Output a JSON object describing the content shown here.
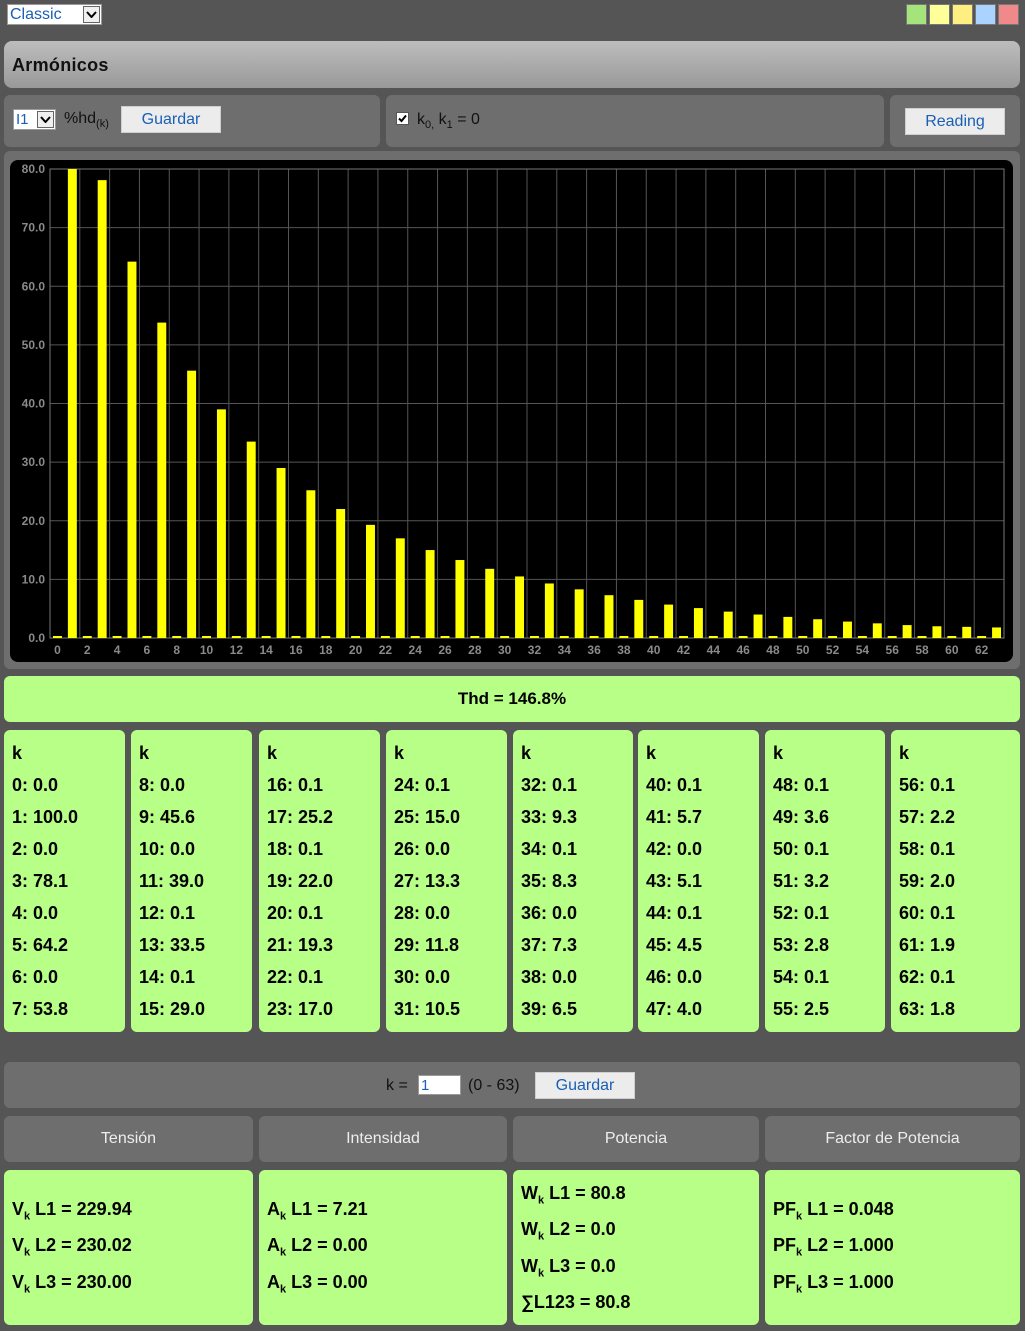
{
  "theme": {
    "selected": "Classic"
  },
  "swatch_colors": [
    "#a5e47a",
    "#ffff99",
    "#ffee80",
    "#aad4ff",
    "#f08a8a"
  ],
  "title": "Armónicos",
  "controls": {
    "line_select": "I1",
    "unit_main": "%hd",
    "unit_sub": "(k)",
    "save_label": "Guardar",
    "k0k1_main": "k",
    "k0k1_sub0": "0,",
    "k0k1_mid": " k",
    "k0k1_sub1": "1",
    "k0k1_tail": " = 0",
    "k0k1_checked": true,
    "reading_label": "Reading"
  },
  "chart_data": {
    "type": "bar",
    "ylim": [
      0,
      80
    ],
    "yticks": [
      "0.0",
      "10.0",
      "20.0",
      "30.0",
      "40.0",
      "50.0",
      "60.0",
      "70.0",
      "80.0"
    ],
    "xticks": [
      "0",
      "2",
      "4",
      "6",
      "8",
      "10",
      "12",
      "14",
      "16",
      "18",
      "20",
      "22",
      "24",
      "26",
      "28",
      "30",
      "32",
      "34",
      "36",
      "38",
      "40",
      "42",
      "44",
      "46",
      "48",
      "50",
      "52",
      "54",
      "56",
      "58",
      "60",
      "62"
    ],
    "bar_color": "#ffff00",
    "values": [
      0.0,
      100.0,
      0.0,
      78.1,
      0.0,
      64.2,
      0.0,
      53.8,
      0.0,
      45.6,
      0.0,
      39.0,
      0.1,
      33.5,
      0.1,
      29.0,
      0.1,
      25.2,
      0.1,
      22.0,
      0.1,
      19.3,
      0.1,
      17.0,
      0.1,
      15.0,
      0.0,
      13.3,
      0.0,
      11.8,
      0.0,
      10.5,
      0.1,
      9.3,
      0.1,
      8.3,
      0.0,
      7.3,
      0.0,
      6.5,
      0.1,
      5.7,
      0.0,
      5.1,
      0.1,
      4.5,
      0.0,
      4.0,
      0.1,
      3.6,
      0.1,
      3.2,
      0.1,
      2.8,
      0.1,
      2.5,
      0.1,
      2.2,
      0.1,
      2.0,
      0.1,
      1.9,
      0.1,
      1.8
    ]
  },
  "thd": "Thd = 146.8%",
  "columns": [
    {
      "header": "k",
      "rows": [
        "0: 0.0",
        "1: 100.0",
        "2: 0.0",
        "3: 78.1",
        "4: 0.0",
        "5: 64.2",
        "6: 0.0",
        "7: 53.8"
      ]
    },
    {
      "header": "k",
      "rows": [
        "8: 0.0",
        "9: 45.6",
        "10: 0.0",
        "11: 39.0",
        "12: 0.1",
        "13: 33.5",
        "14: 0.1",
        "15: 29.0"
      ]
    },
    {
      "header": "k",
      "rows": [
        "16: 0.1",
        "17: 25.2",
        "18: 0.1",
        "19: 22.0",
        "20: 0.1",
        "21: 19.3",
        "22: 0.1",
        "23: 17.0"
      ]
    },
    {
      "header": "k",
      "rows": [
        "24: 0.1",
        "25: 15.0",
        "26: 0.0",
        "27: 13.3",
        "28: 0.0",
        "29: 11.8",
        "30: 0.0",
        "31: 10.5"
      ]
    },
    {
      "header": "k",
      "rows": [
        "32: 0.1",
        "33: 9.3",
        "34: 0.1",
        "35: 8.3",
        "36: 0.0",
        "37: 7.3",
        "38: 0.0",
        "39: 6.5"
      ]
    },
    {
      "header": "k",
      "rows": [
        "40: 0.1",
        "41: 5.7",
        "42: 0.0",
        "43: 5.1",
        "44: 0.1",
        "45: 4.5",
        "46: 0.0",
        "47: 4.0"
      ]
    },
    {
      "header": "k",
      "rows": [
        "48: 0.1",
        "49: 3.6",
        "50: 0.1",
        "51: 3.2",
        "52: 0.1",
        "53: 2.8",
        "54: 0.1",
        "55: 2.5"
      ]
    },
    {
      "header": "k",
      "rows": [
        "56: 0.1",
        "57: 2.2",
        "58: 0.1",
        "59: 2.0",
        "60: 0.1",
        "61: 1.9",
        "62: 0.1",
        "63: 1.8"
      ]
    }
  ],
  "k_selector": {
    "prefix": "k = ",
    "value": "1",
    "range": "(0 - 63)",
    "save_label": "Guardar"
  },
  "measures": {
    "tension": {
      "header": "Tensión",
      "rows": [
        {
          "sym": "V",
          "sub": "k",
          "label": " L1 = 229.94"
        },
        {
          "sym": "V",
          "sub": "k",
          "label": " L2 = 230.02"
        },
        {
          "sym": "V",
          "sub": "k",
          "label": " L3 = 230.00"
        }
      ]
    },
    "intensidad": {
      "header": "Intensidad",
      "rows": [
        {
          "sym": "A",
          "sub": "k",
          "label": " L1 = 7.21"
        },
        {
          "sym": "A",
          "sub": "k",
          "label": " L2 = 0.00"
        },
        {
          "sym": "A",
          "sub": "k",
          "label": " L3 = 0.00"
        }
      ]
    },
    "potencia": {
      "header": "Potencia",
      "rows": [
        {
          "sym": "W",
          "sub": "k",
          "label": " L1 = 80.8"
        },
        {
          "sym": "W",
          "sub": "k",
          "label": " L2 = 0.0"
        },
        {
          "sym": "W",
          "sub": "k",
          "label": " L3 = 0.0"
        }
      ],
      "total": "∑L123 = 80.8"
    },
    "factor": {
      "header": "Factor de Potencia",
      "rows": [
        {
          "sym": "PF",
          "sub": "k",
          "label": " L1 = 0.048"
        },
        {
          "sym": "PF",
          "sub": "k",
          "label": " L2 = 1.000"
        },
        {
          "sym": "PF",
          "sub": "k",
          "label": " L3 = 1.000"
        }
      ]
    }
  }
}
